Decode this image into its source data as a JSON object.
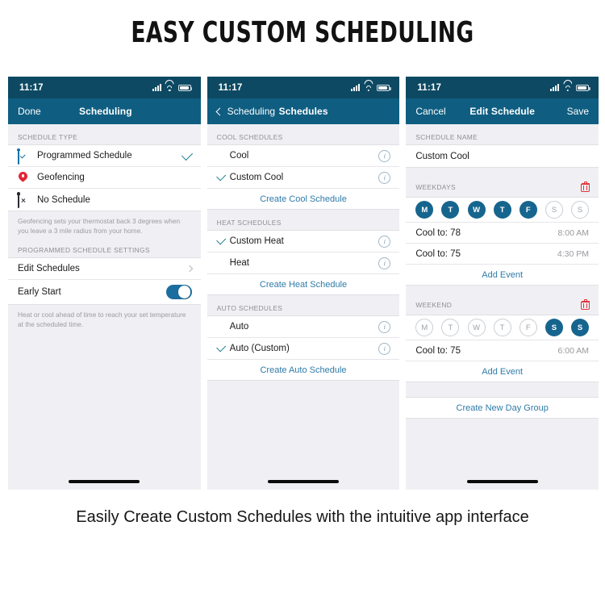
{
  "title": "EASY CUSTOM SCHEDULING",
  "caption": "Easily Create Custom Schedules with the intuitive app interface",
  "colors": {
    "status_bar": "#0d4963",
    "nav_bar": "#0f5e81",
    "accent_link": "#2f7ba8",
    "day_selected": "#16658e",
    "toggle_on": "#1a6d9e",
    "delete_red": "#e1343c",
    "pin_red": "#e32636",
    "check_teal": "#1b7f94",
    "screen_bg": "#f0f0f4"
  },
  "status": {
    "time": "11:17",
    "signal": "cellular-bars",
    "wifi": "wifi-icon",
    "battery": "battery-icon"
  },
  "panel1": {
    "nav": {
      "left": "Done",
      "title": "Scheduling"
    },
    "section_type_header": "SCHEDULE TYPE",
    "types": [
      {
        "label": "Programmed Schedule",
        "icon": "calendar-check-icon",
        "selected": true
      },
      {
        "label": "Geofencing",
        "icon": "location-pin-icon",
        "selected": false
      },
      {
        "label": "No Schedule",
        "icon": "calendar-x-icon",
        "selected": false
      }
    ],
    "geofence_note": "Geofencing sets your thermostat back 3 degrees when you leave a 3 mile radius from your home.",
    "settings_header": "PROGRAMMED SCHEDULE SETTINGS",
    "edit_schedules": "Edit Schedules",
    "early_start": "Early Start",
    "early_start_on": true,
    "early_start_note": "Heat or cool ahead of time to reach your set temperature at the scheduled time."
  },
  "panel2": {
    "nav": {
      "back": "Scheduling",
      "title": "Schedules"
    },
    "sections": [
      {
        "header": "COOL SCHEDULES",
        "items": [
          {
            "label": "Cool",
            "checked": false
          },
          {
            "label": "Custom Cool",
            "checked": true
          }
        ],
        "action": "Create Cool Schedule"
      },
      {
        "header": "HEAT SCHEDULES",
        "items": [
          {
            "label": "Custom Heat",
            "checked": true
          },
          {
            "label": "Heat",
            "checked": false
          }
        ],
        "action": "Create Heat Schedule"
      },
      {
        "header": "AUTO SCHEDULES",
        "items": [
          {
            "label": "Auto",
            "checked": false
          },
          {
            "label": "Auto (Custom)",
            "checked": true
          }
        ],
        "action": "Create Auto Schedule"
      }
    ]
  },
  "panel3": {
    "nav": {
      "left": "Cancel",
      "title": "Edit Schedule",
      "right": "Save"
    },
    "name_header": "SCHEDULE NAME",
    "name_value": "Custom Cool",
    "groups": [
      {
        "header": "WEEKDAYS",
        "days": [
          {
            "letter": "M",
            "on": true
          },
          {
            "letter": "T",
            "on": true
          },
          {
            "letter": "W",
            "on": true
          },
          {
            "letter": "T",
            "on": true
          },
          {
            "letter": "F",
            "on": true
          },
          {
            "letter": "S",
            "on": false
          },
          {
            "letter": "S",
            "on": false
          }
        ],
        "events": [
          {
            "label": "Cool to: 78",
            "time": "8:00 AM"
          },
          {
            "label": "Cool to: 75",
            "time": "4:30 PM"
          }
        ],
        "add": "Add Event"
      },
      {
        "header": "WEEKEND",
        "days": [
          {
            "letter": "M",
            "on": false
          },
          {
            "letter": "T",
            "on": false
          },
          {
            "letter": "W",
            "on": false
          },
          {
            "letter": "T",
            "on": false
          },
          {
            "letter": "F",
            "on": false
          },
          {
            "letter": "S",
            "on": true
          },
          {
            "letter": "S",
            "on": true
          }
        ],
        "events": [
          {
            "label": "Cool to: 75",
            "time": "6:00 AM"
          }
        ],
        "add": "Add Event"
      }
    ],
    "create_group": "Create New Day Group"
  }
}
